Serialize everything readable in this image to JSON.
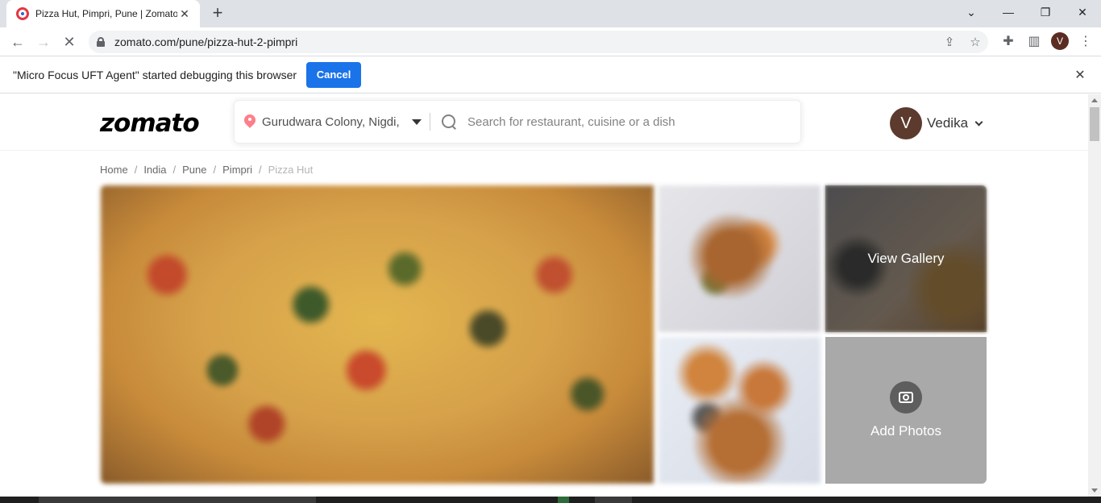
{
  "browser": {
    "tab_title": "Pizza Hut, Pimpri, Pune | Zomato",
    "url": "zomato.com/pune/pizza-hut-2-pimpri",
    "profile_initial": "V"
  },
  "infobar": {
    "message": "\"Micro Focus UFT Agent\" started debugging this browser",
    "cancel_label": "Cancel"
  },
  "zomato": {
    "logo": "zomato",
    "location": "Gurudwara Colony, Nigdi,",
    "search_placeholder": "Search for restaurant, cuisine or a dish",
    "user": {
      "initial": "V",
      "name": "Vedika"
    },
    "breadcrumb": [
      "Home",
      "India",
      "Pune",
      "Pimpri",
      "Pizza Hut"
    ],
    "gallery": {
      "view_gallery_label": "View Gallery",
      "add_photos_label": "Add Photos"
    }
  },
  "colors": {
    "brand": "#e23744",
    "chrome_accent": "#1a73e8",
    "location_pin": "#ff7e8b"
  }
}
